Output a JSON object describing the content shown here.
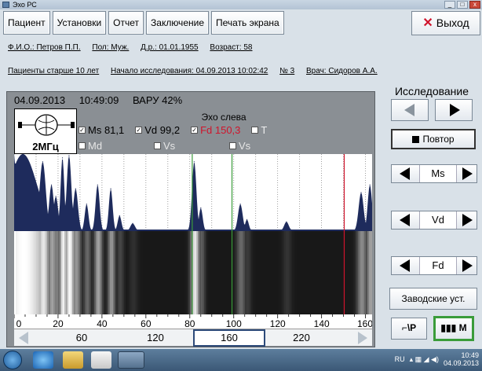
{
  "window": {
    "title": "Эхо РС",
    "minimize": "_",
    "maximize": "□",
    "close": "x"
  },
  "menu": {
    "items": [
      {
        "label": "Пациент"
      },
      {
        "label": "Установки"
      },
      {
        "label": "Отчет"
      },
      {
        "label": "Заключение"
      },
      {
        "label": "Печать экрана"
      }
    ],
    "exit_label": "Выход"
  },
  "patient": {
    "name": "Ф.И.О.: Петров П.П.",
    "sex": "Пол: Муж.",
    "dob": "Д.р.: 01.01.1955",
    "age": "Возраст: 58"
  },
  "study": {
    "group": "Пациенты старше 10 лет",
    "start": "Начало исследования: 04.09.2013  10:02:42",
    "number": "№ 3",
    "doctor": "Врач: Сидоров А.А."
  },
  "status": {
    "date": "04.09.2013",
    "time": "10:49:09",
    "varu": "ВАРУ 42%"
  },
  "probe": {
    "frequency": "2МГц"
  },
  "echo": {
    "title": "Эхо слева",
    "measures_row1": [
      {
        "label": "Ms 81,1",
        "checked": true,
        "color": "#000000"
      },
      {
        "label": "Vd 99,2",
        "checked": true,
        "color": "#000000"
      },
      {
        "label": "Fd 150,3",
        "checked": true,
        "color": "#d0142c"
      },
      {
        "label": "T",
        "checked": false,
        "color": "#eeeeee"
      }
    ],
    "measures_row2": [
      {
        "label": "Md",
        "checked": false,
        "color": "#e6e6e6"
      },
      {
        "label": "Vs",
        "checked": false,
        "color": "#e6e6e6"
      },
      {
        "label": "Vs",
        "checked": false,
        "color": "#e6e6e6"
      }
    ]
  },
  "chart_data": {
    "type": "area",
    "x_ticks": [
      0,
      20,
      40,
      60,
      80,
      100,
      120,
      140,
      160
    ],
    "xlim": [
      0,
      163
    ],
    "markers": [
      {
        "name": "Ms",
        "x": 81.1,
        "color": "#3a9c3a"
      },
      {
        "name": "Vd",
        "x": 99.2,
        "color": "#3a9c3a"
      },
      {
        "name": "Fd",
        "x": 150.3,
        "color": "#d0142c"
      }
    ],
    "peaks": [
      {
        "x": 0,
        "y": 1.0,
        "w": 1
      },
      {
        "x": 4,
        "y": 1.0,
        "w": 9
      },
      {
        "x": 13,
        "y": 0.9,
        "w": 2
      },
      {
        "x": 17,
        "y": 0.6,
        "w": 1.5
      },
      {
        "x": 19,
        "y": 0.45,
        "w": 1.5
      },
      {
        "x": 22,
        "y": 0.95,
        "w": 1.2
      },
      {
        "x": 25,
        "y": 0.98,
        "w": 1.5
      },
      {
        "x": 28,
        "y": 0.55,
        "w": 1.5
      },
      {
        "x": 33,
        "y": 0.35,
        "w": 1.2
      },
      {
        "x": 38,
        "y": 0.6,
        "w": 1.3
      },
      {
        "x": 44,
        "y": 0.55,
        "w": 1.2
      },
      {
        "x": 48,
        "y": 0.2,
        "w": 1.2
      },
      {
        "x": 54,
        "y": 0.1,
        "w": 1.5
      },
      {
        "x": 82,
        "y": 0.9,
        "w": 1.4
      },
      {
        "x": 85,
        "y": 0.3,
        "w": 1.2
      },
      {
        "x": 103,
        "y": 0.35,
        "w": 1.5
      },
      {
        "x": 106,
        "y": 0.15,
        "w": 1.2
      },
      {
        "x": 124,
        "y": 0.12,
        "w": 1.5
      },
      {
        "x": 158,
        "y": 0.5,
        "w": 1.6
      },
      {
        "x": 162,
        "y": 0.6,
        "w": 1.4
      }
    ]
  },
  "scroll": {
    "labels": [
      "60",
      "120",
      "160",
      "220"
    ]
  },
  "right_panel": {
    "title": "Исследование",
    "replay_label": "Повтор",
    "ms_label": "Ms",
    "vd_label": "Vd",
    "fd_label": "Fd",
    "factory_label": "Заводские уст.",
    "p_label": "P",
    "m_label": "M"
  },
  "taskbar": {
    "lang": "RU",
    "time": "10:49",
    "date": "04.09.2013"
  }
}
